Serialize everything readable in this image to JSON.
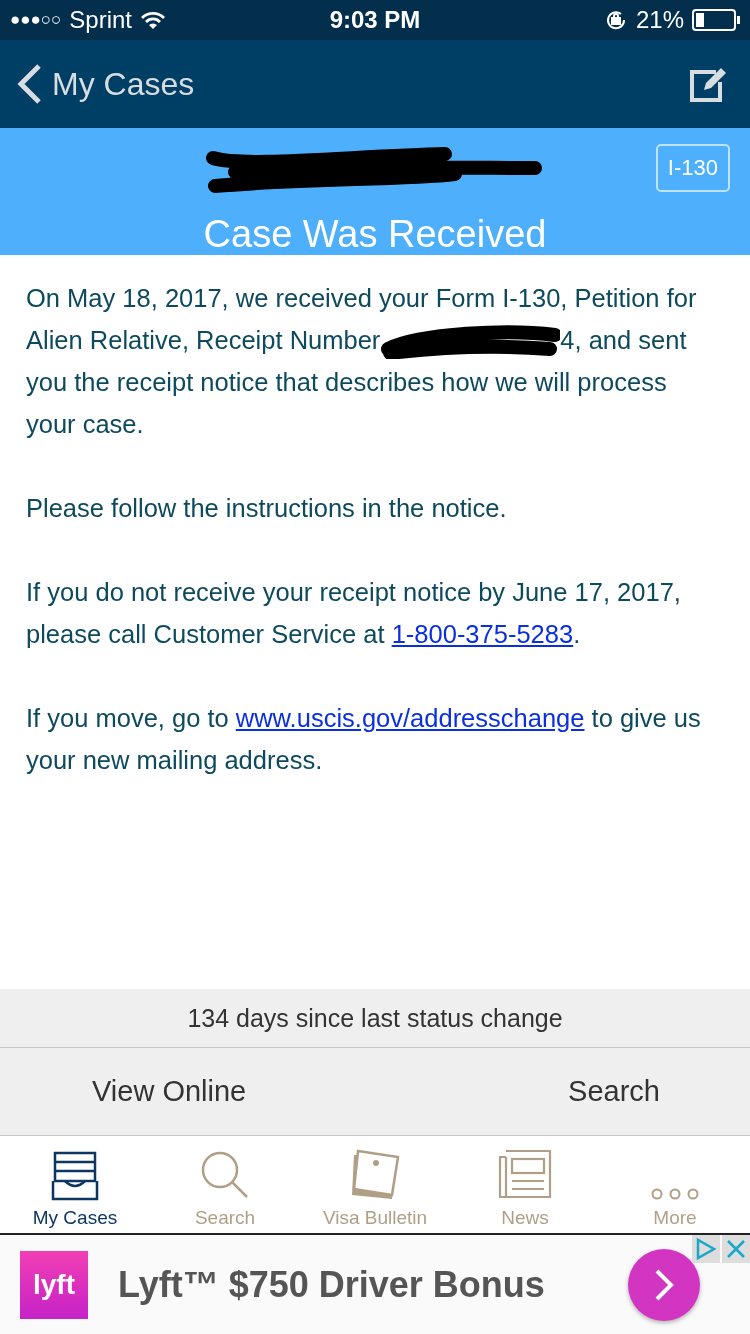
{
  "status_bar": {
    "signal": "●●●○○",
    "carrier": "Sprint",
    "time": "9:03 PM",
    "battery": "21%"
  },
  "nav": {
    "back": "My Cases"
  },
  "case": {
    "form_badge": "I-130",
    "status": "Case Was Received"
  },
  "paragraphs": [
    {
      "parts": [
        {
          "kind": "text",
          "text": "On May 18, 2017, we received your Form I-130, Petition for Alien Relative, Receipt Number"
        },
        {
          "kind": "redaction"
        },
        {
          "kind": "text",
          "text": "4, and sent you the receipt notice that describes how we will process your case."
        }
      ]
    },
    {
      "parts": [
        {
          "kind": "text",
          "text": "Please follow the instructions in the notice."
        }
      ]
    },
    {
      "parts": [
        {
          "kind": "text",
          "text": "If you do not receive your receipt notice by June 17, 2017, please call Customer Service at "
        },
        {
          "kind": "link",
          "text": "1-800-375-5283"
        },
        {
          "kind": "text",
          "text": "."
        }
      ]
    },
    {
      "parts": [
        {
          "kind": "text",
          "text": "If you move, go to "
        },
        {
          "kind": "link",
          "text": "www.uscis.gov/addresschange"
        },
        {
          "kind": "text",
          "text": " to give us your new mailing address."
        }
      ]
    }
  ],
  "days_since_change": "134 days since last status change",
  "actions": [
    "View Online",
    "Search"
  ],
  "tabs": [
    {
      "label": "My Cases",
      "kind": "cases",
      "selected": true
    },
    {
      "label": "Search",
      "kind": "search",
      "selected": false
    },
    {
      "label": "Visa Bulletin",
      "kind": "bulletin",
      "selected": false
    },
    {
      "label": "News",
      "kind": "news",
      "selected": false
    },
    {
      "label": "More",
      "kind": "more",
      "selected": false
    }
  ],
  "ad": {
    "logo": "lyft",
    "text": "Lyft™ $750 Driver Bonus"
  }
}
